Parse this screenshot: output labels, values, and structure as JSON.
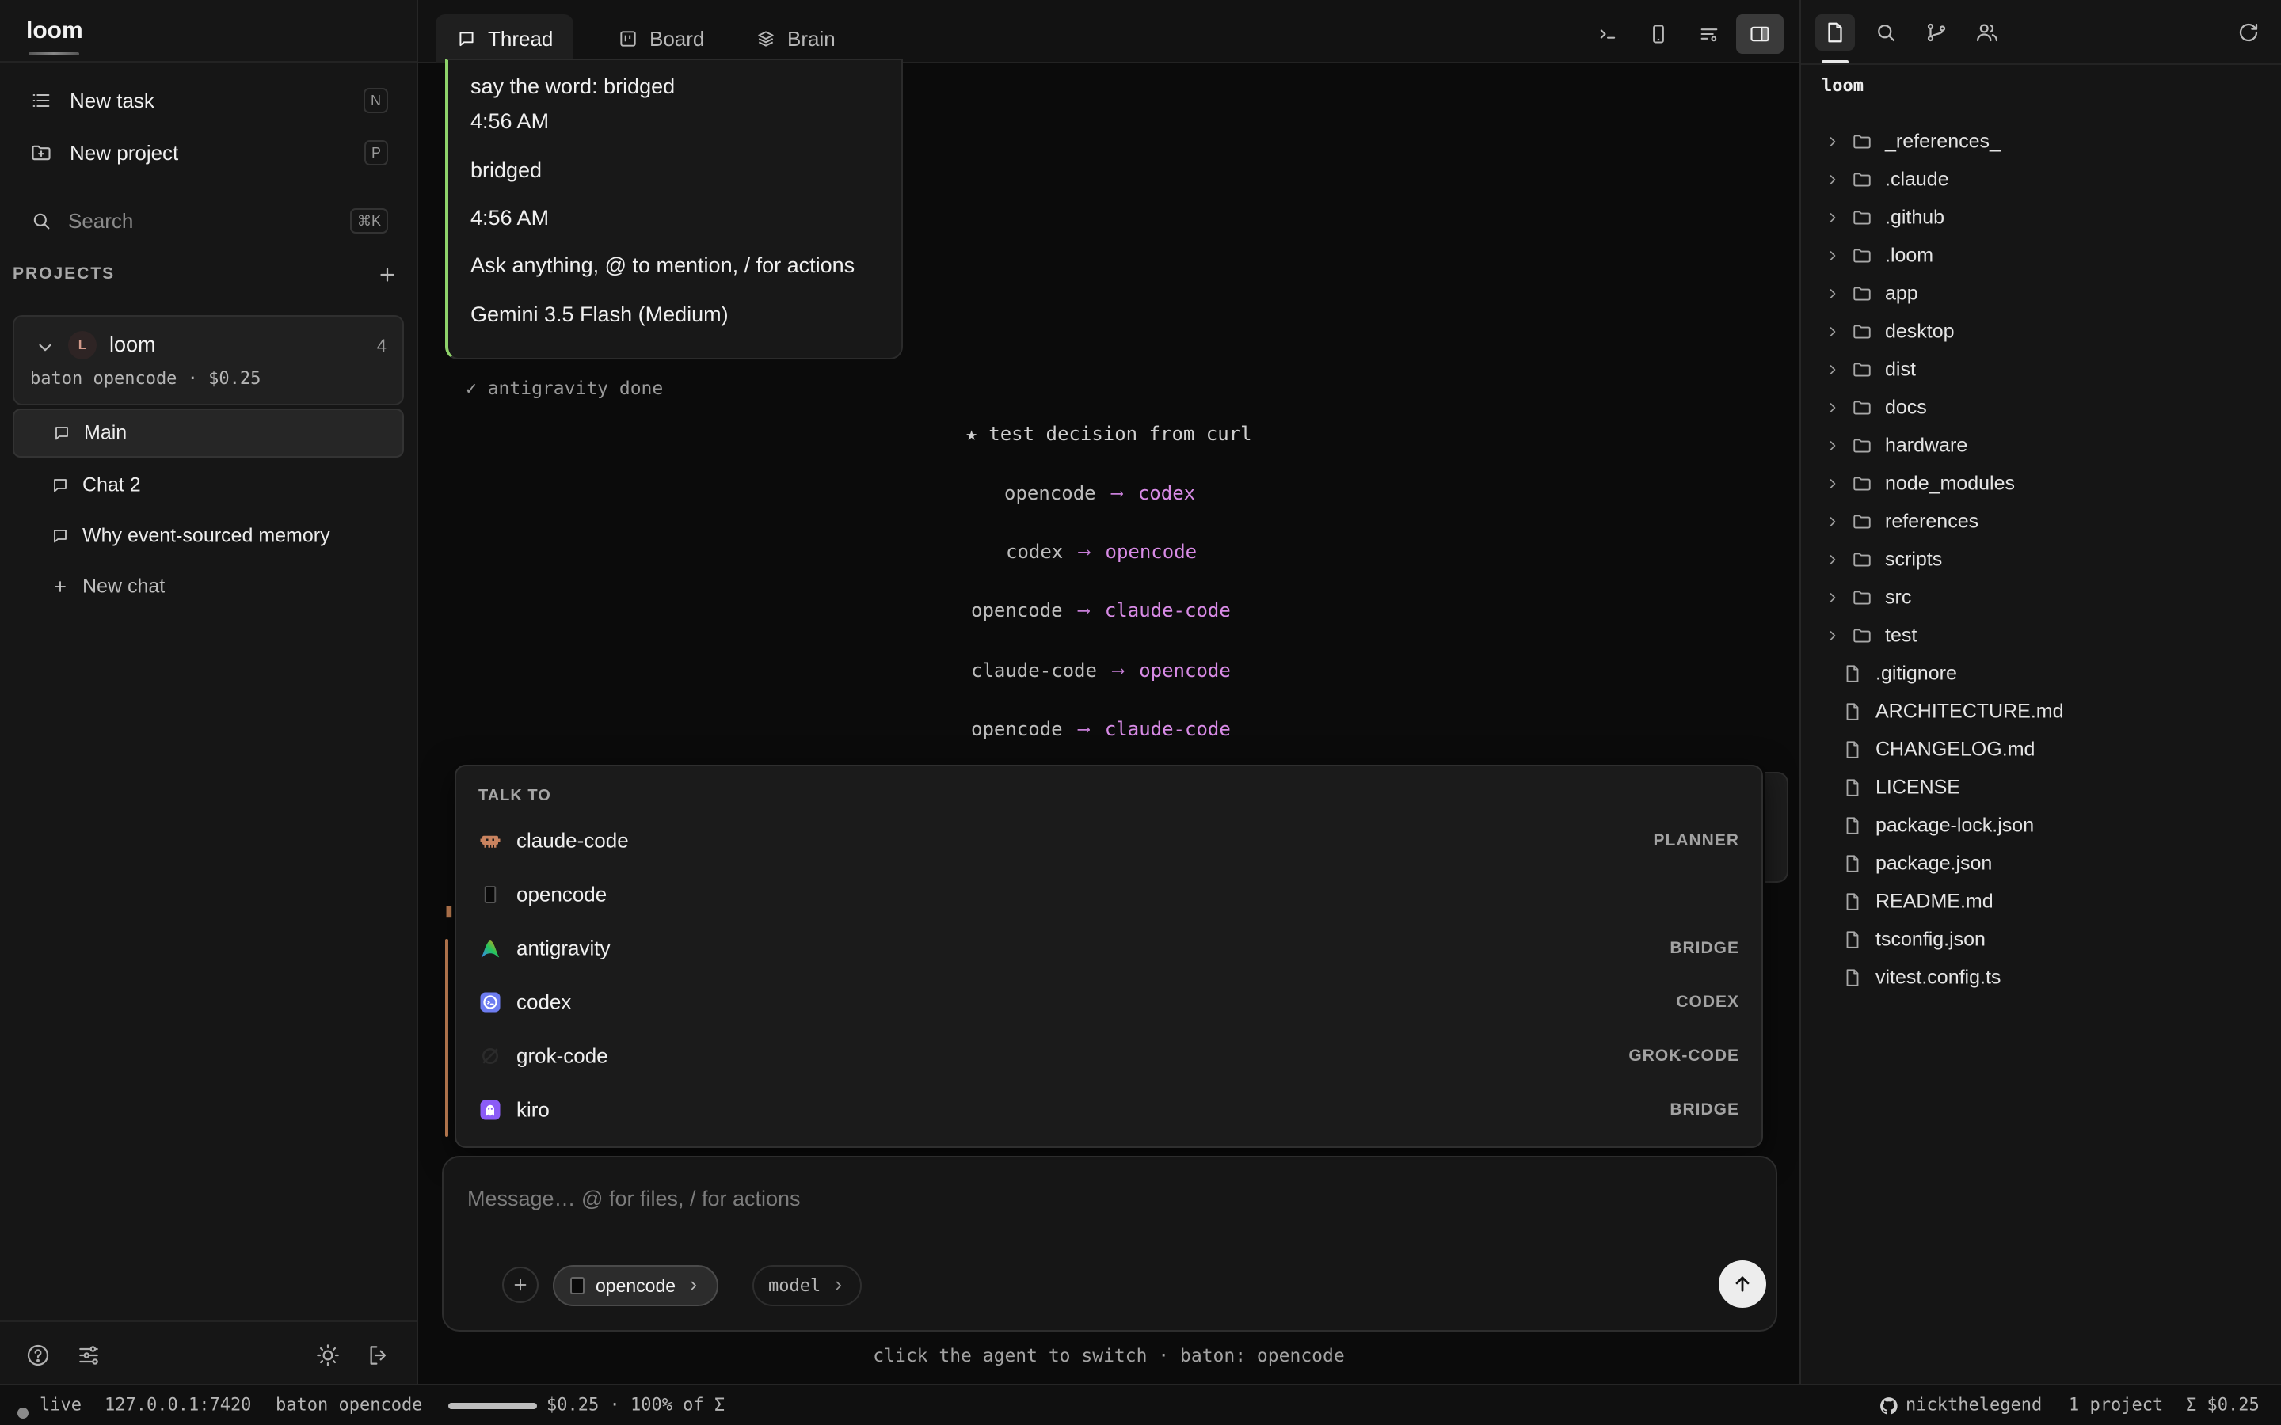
{
  "sidebar": {
    "brand": "loom",
    "new_task": {
      "label": "New task",
      "shortcut": "N"
    },
    "new_project": {
      "label": "New project",
      "shortcut": "P"
    },
    "search": {
      "label": "Search",
      "shortcut": "⌘K"
    },
    "projects_header": "PROJECTS",
    "project": {
      "avatar": "L",
      "name": "loom",
      "count": "4",
      "meta": "baton opencode · $0.25"
    },
    "chats": [
      {
        "label": "Main",
        "active": true
      },
      {
        "label": "Chat 2",
        "active": false
      },
      {
        "label": "Why event-sourced memory",
        "active": false
      }
    ],
    "new_chat": "New chat",
    "footer_icons": [
      "help-icon",
      "settings-sliders-icon",
      "theme-sun-icon",
      "logout-icon"
    ]
  },
  "topbar": {
    "tabs": [
      {
        "label": "Thread",
        "icon": "chat-bubble-icon",
        "active": true
      },
      {
        "label": "Board",
        "icon": "board-icon",
        "active": false
      },
      {
        "label": "Brain",
        "icon": "layers-icon",
        "active": false
      }
    ],
    "actions": [
      "terminal-icon",
      "mobile-icon",
      "filter-icon",
      "panel-toggle-icon"
    ]
  },
  "thread": {
    "message_card": {
      "lines": [
        "say the word: bridged",
        "4:56 AM",
        "bridged",
        "4:56 AM",
        "Ask anything, @ to mention, / for actions",
        "Gemini 3.5 Flash (Medium)"
      ]
    },
    "done_line": "✓ antigravity done",
    "decision": "★ test decision from curl",
    "handoffs": [
      {
        "from": "opencode",
        "to": "codex"
      },
      {
        "from": "codex",
        "to": "opencode"
      },
      {
        "from": "opencode",
        "to": "claude-code"
      },
      {
        "from": "claude-code",
        "to": "opencode"
      },
      {
        "from": "opencode",
        "to": "claude-code"
      }
    ],
    "arrow": "⟶"
  },
  "talk_to": {
    "title": "TALK TO",
    "agents": [
      {
        "name": "claude-code",
        "role": "PLANNER",
        "icon": "claude-crab-icon"
      },
      {
        "name": "opencode",
        "role": "",
        "icon": "opencode-icon"
      },
      {
        "name": "antigravity",
        "role": "BRIDGE",
        "icon": "antigravity-icon"
      },
      {
        "name": "codex",
        "role": "CODEX",
        "icon": "codex-icon"
      },
      {
        "name": "grok-code",
        "role": "GROK-CODE",
        "icon": "grok-icon"
      },
      {
        "name": "kiro",
        "role": "BRIDGE",
        "icon": "kiro-ghost-icon"
      }
    ]
  },
  "composer": {
    "placeholder": "Message… @ for files, / for actions",
    "agent": "opencode",
    "model": "model",
    "hint": "click the agent to switch · baton: opencode"
  },
  "files": {
    "root": "loom",
    "folders": [
      "_references_",
      ".claude",
      ".github",
      ".loom",
      "app",
      "desktop",
      "dist",
      "docs",
      "hardware",
      "node_modules",
      "references",
      "scripts",
      "src",
      "test"
    ],
    "files": [
      ".gitignore",
      "ARCHITECTURE.md",
      "CHANGELOG.md",
      "LICENSE",
      "package-lock.json",
      "package.json",
      "README.md",
      "tsconfig.json",
      "vitest.config.ts"
    ]
  },
  "status": {
    "live": "live",
    "address": "127.0.0.1:7420",
    "baton": "baton opencode",
    "budget_fraction": 1.0,
    "cost": "$0.25 · 100% of Σ",
    "user": "nickthelegend",
    "projects": "1 project",
    "total": "Σ $0.25"
  }
}
